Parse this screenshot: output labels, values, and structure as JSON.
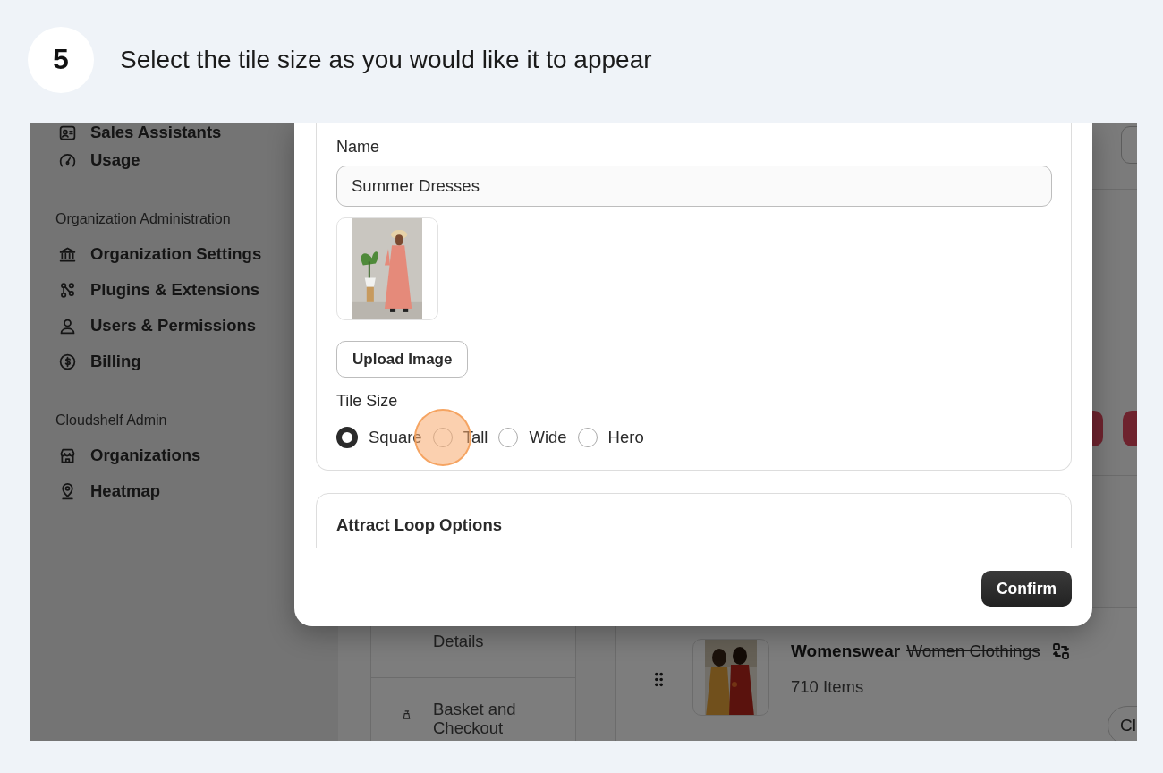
{
  "step": {
    "number": "5",
    "instruction": "Select the tile size as you would like it to appear"
  },
  "sidebar": {
    "groups": [
      {
        "items": [
          "Sales Assistants",
          "Usage"
        ]
      },
      {
        "heading": "Organization Administration",
        "items": [
          "Organization Settings",
          "Plugins & Extensions",
          "Users & Permissions",
          "Billing"
        ]
      },
      {
        "heading": "Cloudshelf Admin",
        "items": [
          "Organizations",
          "Heatmap"
        ]
      }
    ]
  },
  "settings_panel": {
    "items": [
      "Details",
      "Basket and Checkout"
    ]
  },
  "product": {
    "name": "Womenswear",
    "original_name": "Women Clothings",
    "count": "710 Items",
    "button": "Cl"
  },
  "modal": {
    "name_label": "Name",
    "name_value": "Summer Dresses",
    "upload_button": "Upload Image",
    "tile_size_label": "Tile Size",
    "tile_sizes": [
      {
        "label": "Square",
        "selected": true,
        "highlighted": false
      },
      {
        "label": "Tall",
        "selected": false,
        "highlighted": true
      },
      {
        "label": "Wide",
        "selected": false,
        "highlighted": false
      },
      {
        "label": "Hero",
        "selected": false,
        "highlighted": false
      }
    ],
    "section_title": "Attract Loop Options",
    "confirm_button": "Confirm"
  }
}
